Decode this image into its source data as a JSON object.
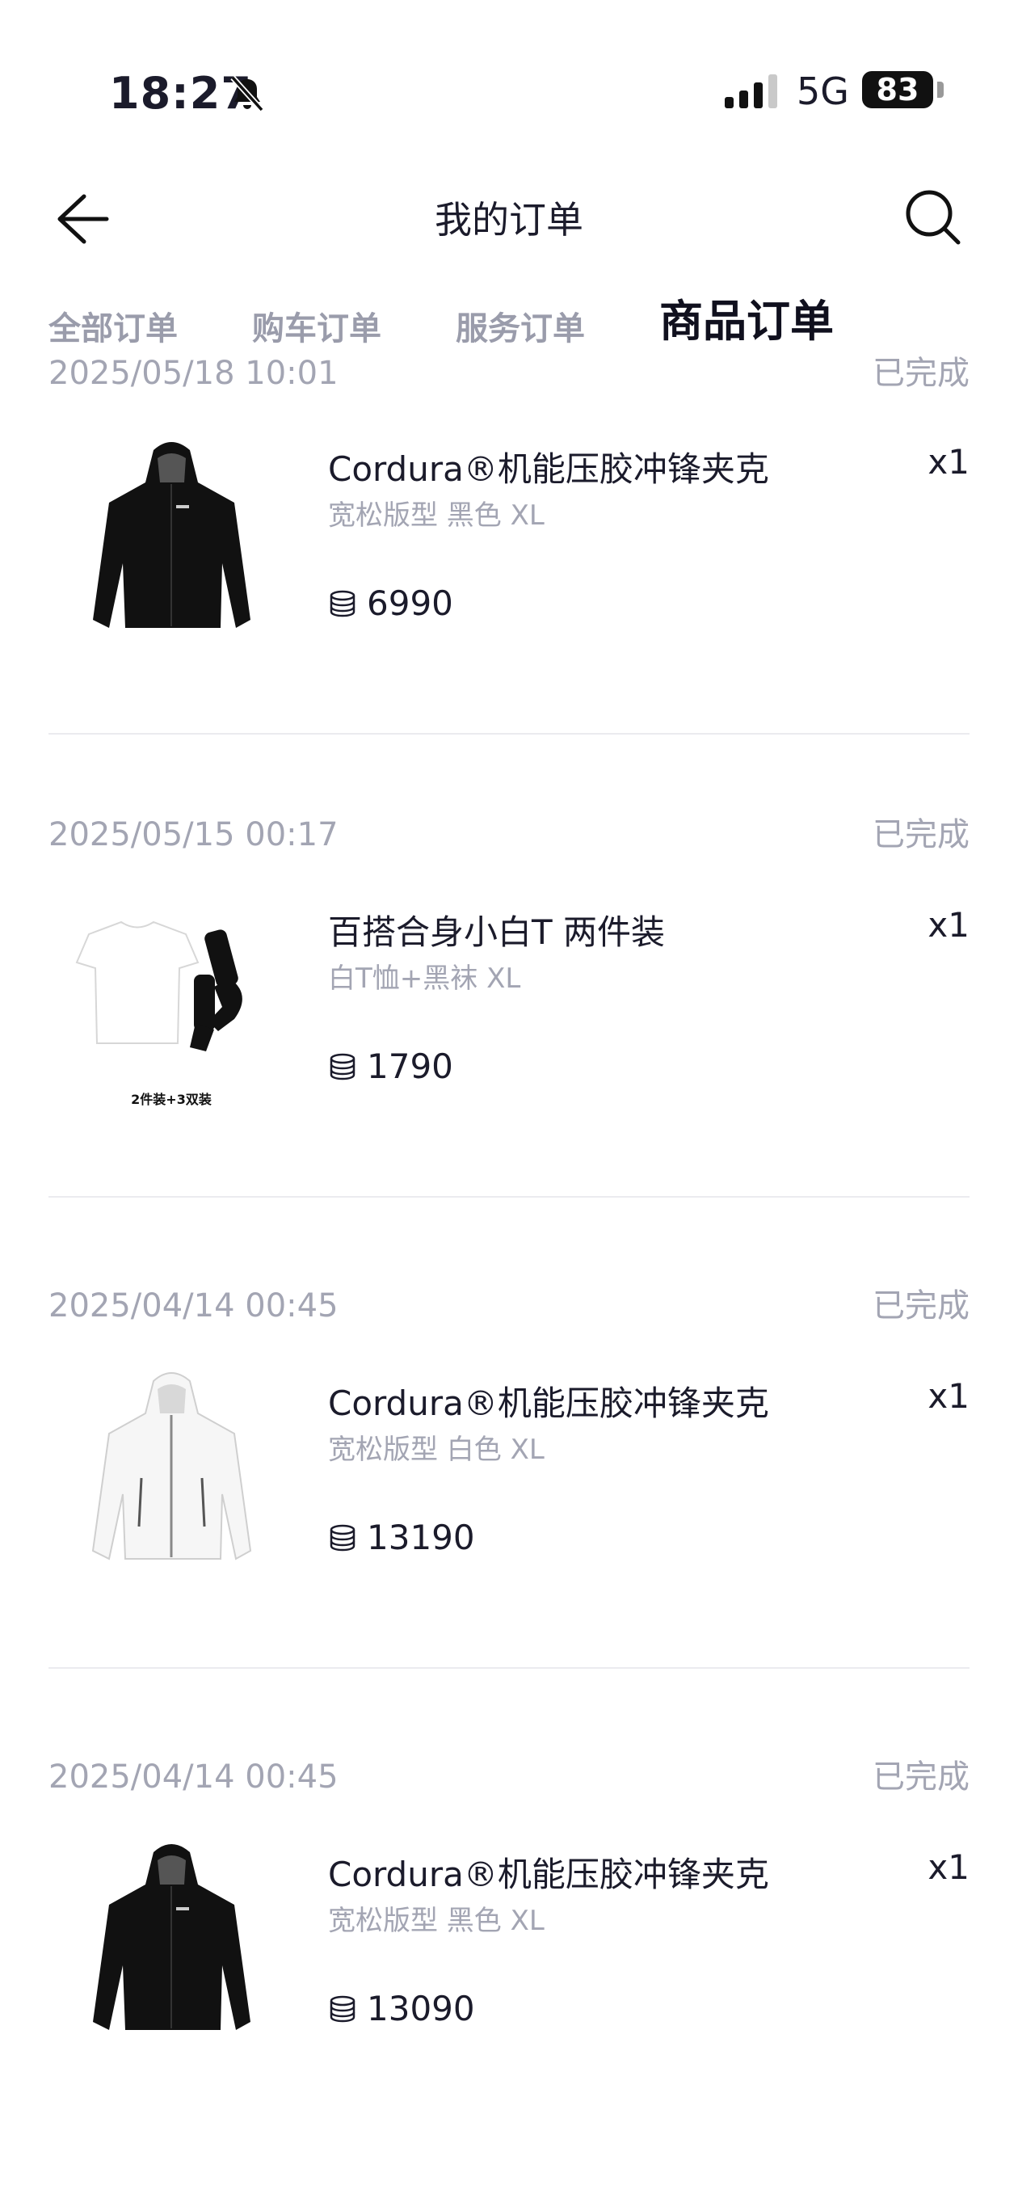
{
  "status_bar": {
    "time": "18:27",
    "network": "5G",
    "battery": "83"
  },
  "header": {
    "title": "我的订单"
  },
  "tabs": [
    {
      "label": "全部订单"
    },
    {
      "label": "购车订单"
    },
    {
      "label": "服务订单"
    },
    {
      "label": "商品订单",
      "active": true
    }
  ],
  "orders": [
    {
      "date": "2025/05/18 10:01",
      "status": "已完成",
      "name": "Cordura®机能压胶冲锋夹克",
      "spec": "宽松版型 黑色 XL",
      "qty": "x1",
      "price": "6990",
      "image": "black-jacket"
    },
    {
      "date": "2025/05/15 00:17",
      "status": "已完成",
      "name": "百搭合身小白T 两件装",
      "spec": "白T恤+黑袜 XL",
      "qty": "x1",
      "price": "1790",
      "image": "tshirt-socks",
      "image_caption": "2件装+3双装"
    },
    {
      "date": "2025/04/14 00:45",
      "status": "已完成",
      "name": "Cordura®机能压胶冲锋夹克",
      "spec": "宽松版型 白色 XL",
      "qty": "x1",
      "price": "13190",
      "image": "white-jacket"
    },
    {
      "date": "2025/04/14 00:45",
      "status": "已完成",
      "name": "Cordura®机能压胶冲锋夹克",
      "spec": "宽松版型 黑色 XL",
      "qty": "x1",
      "price": "13090",
      "image": "black-jacket"
    }
  ],
  "icons": {
    "coin": "coin-stack-icon",
    "back": "arrow-left-icon",
    "search": "search-icon",
    "bell": "bell-slash-icon"
  }
}
